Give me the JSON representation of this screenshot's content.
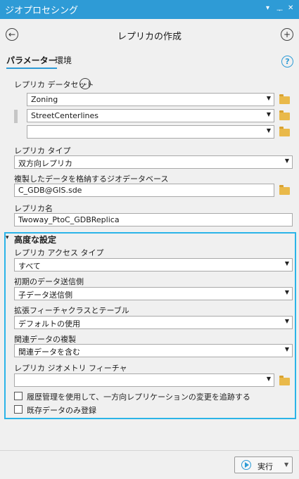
{
  "window": {
    "title": "ジオプロセシング",
    "ctrl_menu": "▾",
    "ctrl_pin": "ᅮ",
    "ctrl_close": "✕"
  },
  "toolbar": {
    "back_glyph": "←",
    "tool_title": "レプリカの作成",
    "add_glyph": "+"
  },
  "tabs": {
    "parameters": "パラメーター",
    "environments": "環境",
    "help": "?"
  },
  "params": {
    "datasets_label": "レプリカ データセット",
    "datasets": [
      "Zoning",
      "StreetCenterlines",
      ""
    ],
    "type_label": "レプリカ タイプ",
    "type_value": "双方向レプリカ",
    "geodatabase_label": "複製したデータを格納するジオデータベース",
    "geodatabase_value": "C_GDB@GIS.sde",
    "name_label": "レプリカ名",
    "name_value": "Twoway_PtoC_GDBReplica"
  },
  "advanced": {
    "header": "高度な設定",
    "access_label": "レプリカ アクセス タイプ",
    "access_value": "すべて",
    "sender_label": "初期のデータ送信側",
    "sender_value": "子データ送信側",
    "expand_label": "拡張フィーチャクラスとテーブル",
    "expand_value": "デフォルトの使用",
    "related_label": "関連データの複製",
    "related_value": "関連データを含む",
    "geometry_label": "レプリカ ジオメトリ フィーチャ",
    "geometry_value": "",
    "track_label": "履歴管理を使用して、一方向レプリケーションの変更を追跡する",
    "register_label": "既存データのみ登録"
  },
  "run": {
    "label": "実行"
  },
  "colors": {
    "accent": "#2e9bd6",
    "highlight_border": "#2bb4e8",
    "folder": "#e9b94a"
  }
}
